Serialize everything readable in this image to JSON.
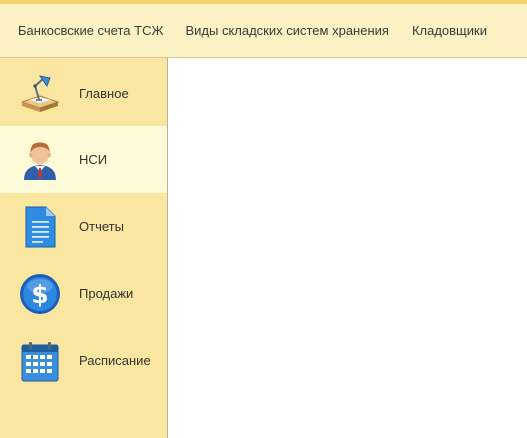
{
  "topbar": {
    "links": [
      "Банкосвские счета ТСЖ",
      "Виды складских систем хранения",
      "Кладовщики"
    ]
  },
  "sidebar": {
    "items": [
      {
        "label": "Главное",
        "icon": "desk-lamp-icon",
        "active": false
      },
      {
        "label": "НСИ",
        "icon": "user-icon",
        "active": true
      },
      {
        "label": "Отчеты",
        "icon": "document-icon",
        "active": false
      },
      {
        "label": "Продажи",
        "icon": "dollar-coin-icon",
        "active": false
      },
      {
        "label": "Расписание",
        "icon": "calendar-icon",
        "active": false
      }
    ]
  },
  "colors": {
    "topbar_bg": "#fbf1c2",
    "sidebar_bg": "#f8e6a1",
    "active_bg": "#fffad8"
  }
}
